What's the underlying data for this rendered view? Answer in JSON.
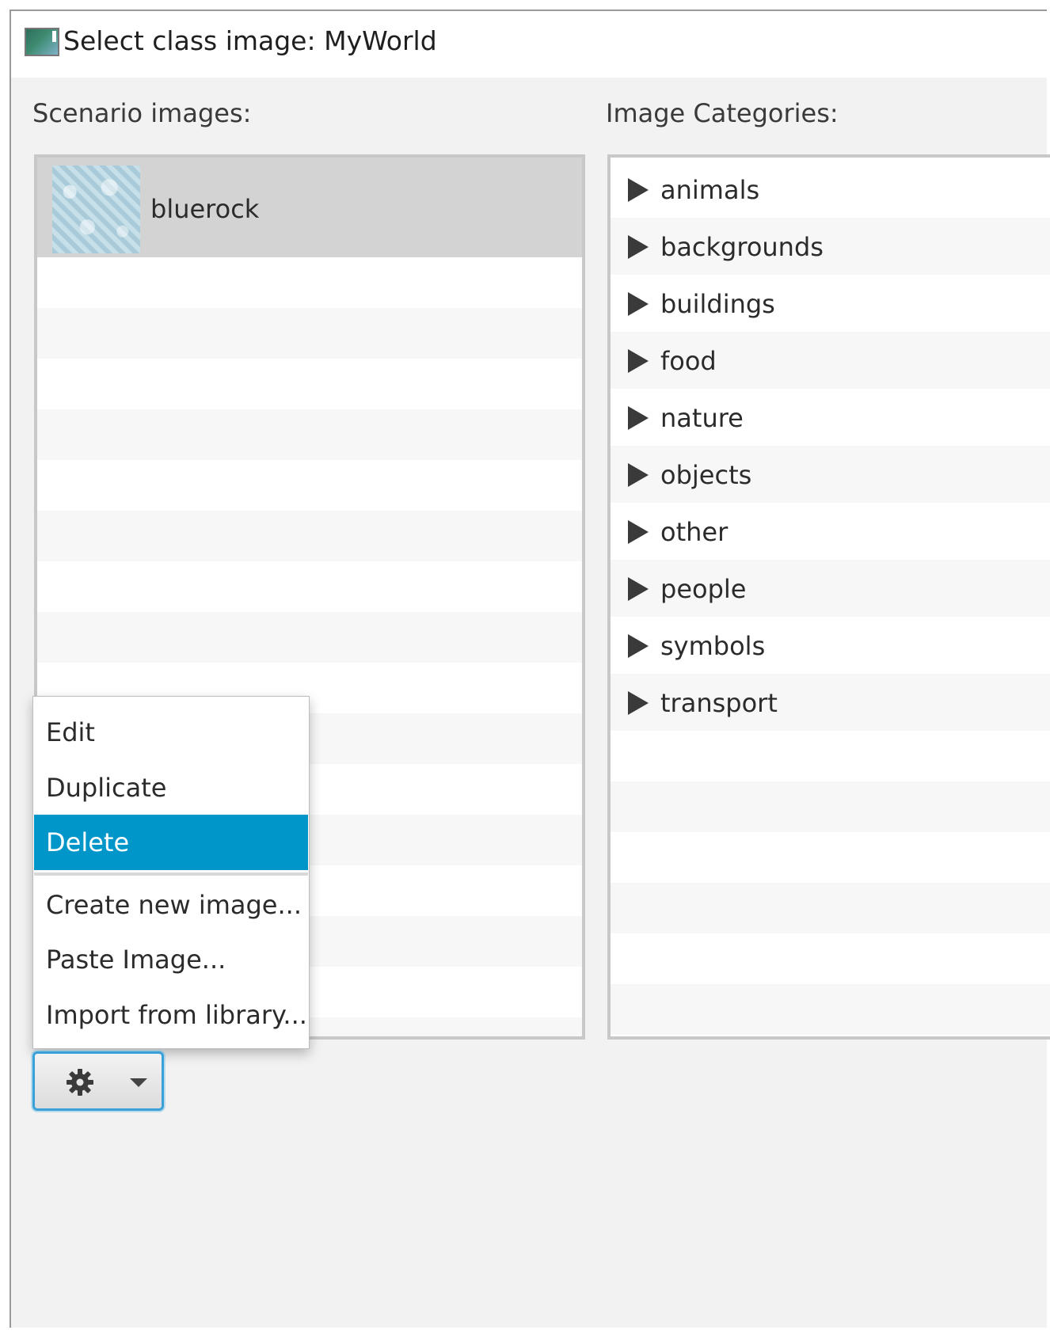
{
  "window": {
    "title": "Select class image: MyWorld"
  },
  "left_panel": {
    "label": "Scenario images:",
    "items": [
      {
        "label": "bluerock"
      }
    ]
  },
  "right_panel": {
    "label": "Image Categories:",
    "categories": [
      "animals",
      "backgrounds",
      "buildings",
      "food",
      "nature",
      "objects",
      "other",
      "people",
      "symbols",
      "transport"
    ]
  },
  "context_menu": {
    "items": [
      "Edit",
      "Duplicate",
      "Delete",
      "Create new image...",
      "Paste Image...",
      "Import from library..."
    ],
    "highlighted": "Delete"
  },
  "toolbar": {
    "gear_button_icon": "gear-icon",
    "dropdown_icon": "chevron-down-icon"
  },
  "colors": {
    "accent": "#0096c9",
    "selection": "#d3d3d3",
    "focus_border": "#3aa0d8"
  }
}
